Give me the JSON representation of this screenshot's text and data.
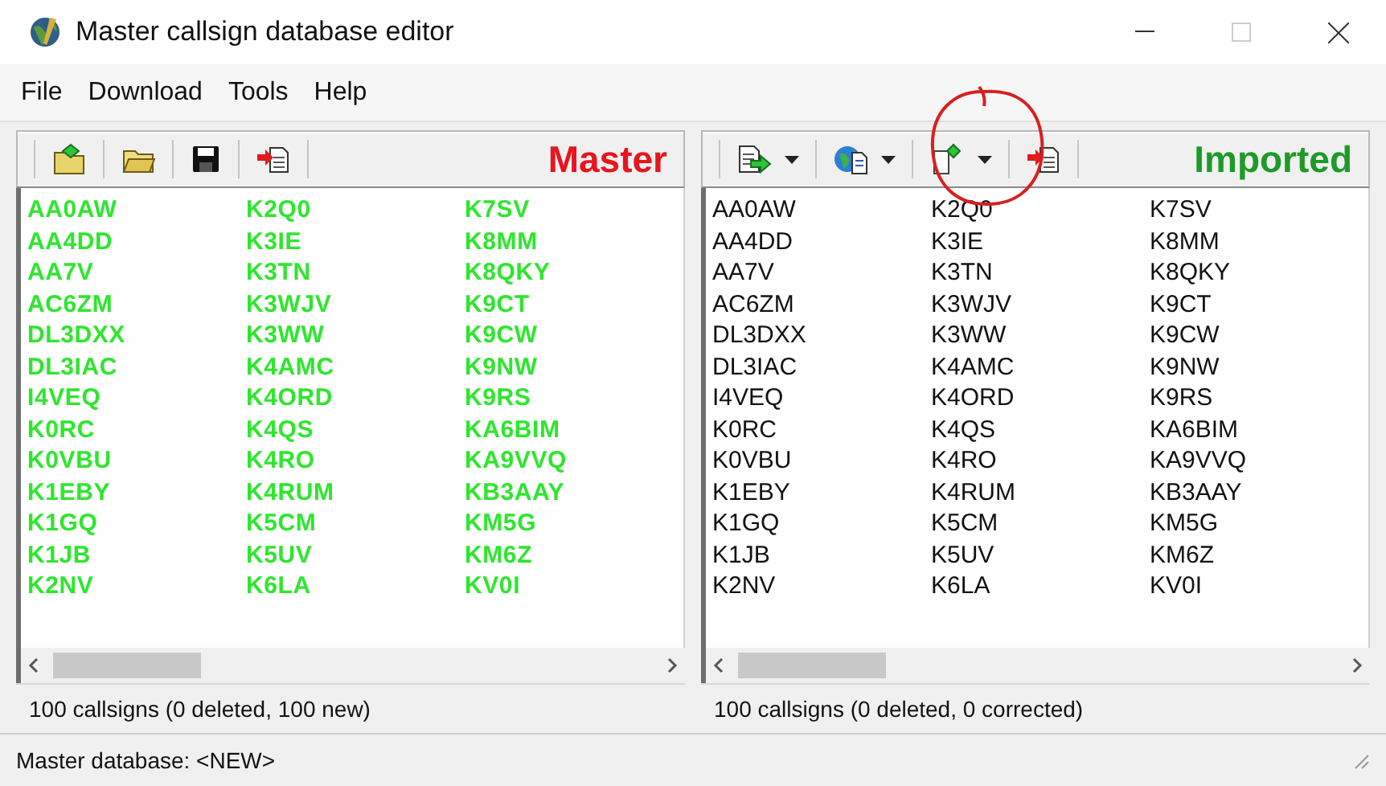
{
  "window": {
    "title": "Master callsign database editor"
  },
  "menu": [
    "File",
    "Download",
    "Tools",
    "Help"
  ],
  "panes": [
    {
      "kind": "master",
      "title": "Master",
      "color": "#e8141e",
      "tools": [
        {
          "kind": "new",
          "dropdown": false
        },
        {
          "kind": "open",
          "dropdown": false
        },
        {
          "kind": "save",
          "dropdown": false
        },
        {
          "kind": "import",
          "dropdown": false
        }
      ],
      "rows": [
        [
          "AA0AW",
          "K2Q0",
          "K7SV"
        ],
        [
          "AA4DD",
          "K3IE",
          "K8MM"
        ],
        [
          "AA7V",
          "K3TN",
          "K8QKY"
        ],
        [
          "AC6ZM",
          "K3WJV",
          "K9CT"
        ],
        [
          "DL3DXX",
          "K3WW",
          "K9CW"
        ],
        [
          "DL3IAC",
          "K4AMC",
          "K9NW"
        ],
        [
          "I4VEQ",
          "K4ORD",
          "K9RS"
        ],
        [
          "K0RC",
          "K4QS",
          "KA6BIM"
        ],
        [
          "K0VBU",
          "K4RO",
          "KA9VVQ"
        ],
        [
          "K1EBY",
          "K4RUM",
          "KB3AAY"
        ],
        [
          "K1GQ",
          "K5CM",
          "KM5G"
        ],
        [
          "K1JB",
          "K5UV",
          "KM6Z"
        ],
        [
          "K2NV",
          "K6LA",
          "KV0I"
        ]
      ],
      "status": "100 callsigns (0 deleted, 100 new)"
    },
    {
      "kind": "imported",
      "title": "Imported",
      "color": "#1e9a2a",
      "tools": [
        {
          "kind": "export",
          "dropdown": true
        },
        {
          "kind": "globe",
          "dropdown": true
        },
        {
          "kind": "newdoc",
          "dropdown": true
        },
        {
          "kind": "import",
          "dropdown": false
        }
      ],
      "rows": [
        [
          "AA0AW",
          "K2Q0",
          "K7SV"
        ],
        [
          "AA4DD",
          "K3IE",
          "K8MM"
        ],
        [
          "AA7V",
          "K3TN",
          "K8QKY"
        ],
        [
          "AC6ZM",
          "K3WJV",
          "K9CT"
        ],
        [
          "DL3DXX",
          "K3WW",
          "K9CW"
        ],
        [
          "DL3IAC",
          "K4AMC",
          "K9NW"
        ],
        [
          "I4VEQ",
          "K4ORD",
          "K9RS"
        ],
        [
          "K0RC",
          "K4QS",
          "KA6BIM"
        ],
        [
          "K0VBU",
          "K4RO",
          "KA9VVQ"
        ],
        [
          "K1EBY",
          "K4RUM",
          "KB3AAY"
        ],
        [
          "K1GQ",
          "K5CM",
          "KM5G"
        ],
        [
          "K1JB",
          "K5UV",
          "KM6Z"
        ],
        [
          "K2NV",
          "K6LA",
          "KV0I"
        ]
      ],
      "status": "100 callsigns (0 deleted, 0 corrected)"
    }
  ],
  "status_bar": "Master database: <NEW>"
}
